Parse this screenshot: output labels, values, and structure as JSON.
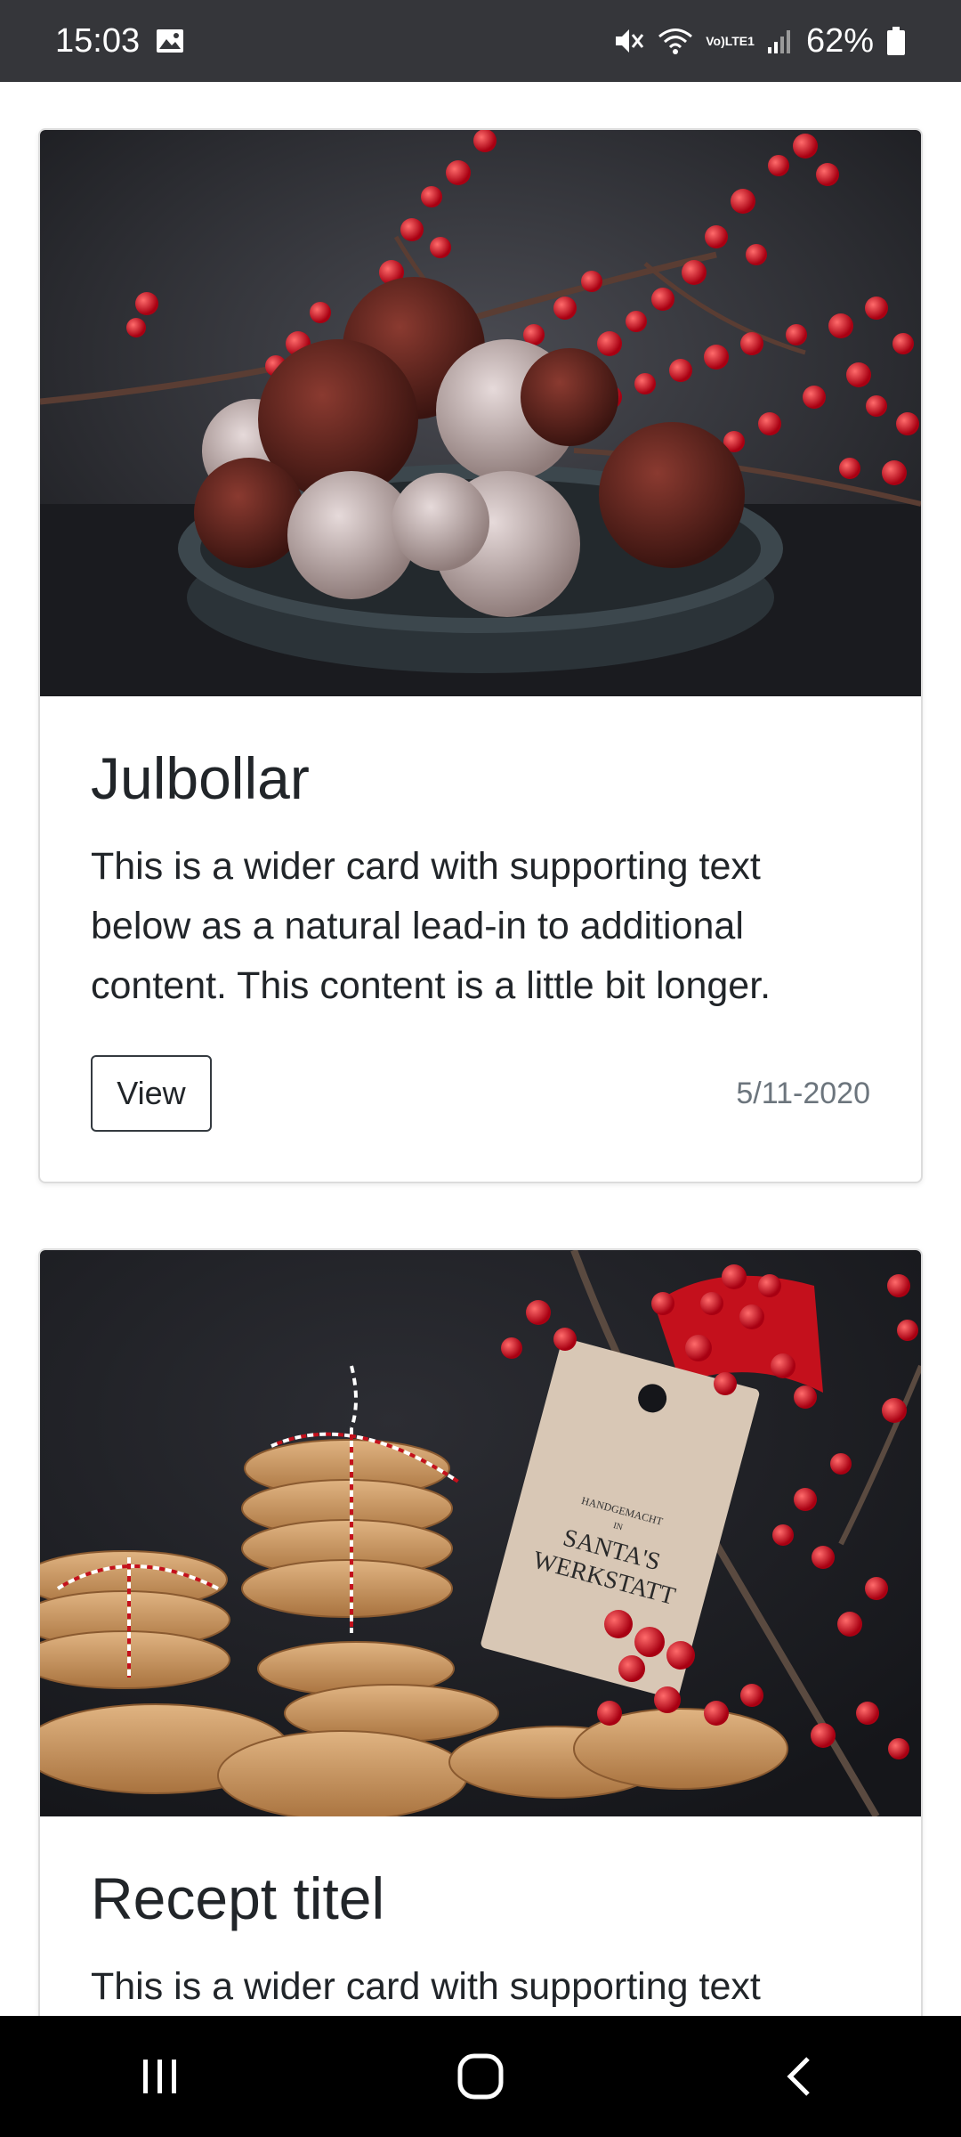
{
  "status_bar": {
    "time": "15:03",
    "battery": "62%",
    "lte_top": "Vo)",
    "lte_bottom": "LTE1",
    "icons": [
      "image-icon",
      "mute-icon",
      "wifi-icon",
      "signal-icon",
      "battery-icon"
    ]
  },
  "cards": [
    {
      "title": "Julbollar",
      "text": "This is a wider card with supporting text below as a natural lead-in to additional content. This content is a little bit longer.",
      "button_label": "View",
      "date": "5/11-2020",
      "image": "chocolate-balls-photo"
    },
    {
      "title": "Recept titel",
      "text": "This is a wider card with supporting text",
      "image": "cookies-photo",
      "tag_line1": "HANDGEMACHT",
      "tag_line2": "IN",
      "tag_line3": "SANTA'S",
      "tag_line4": "WERKSTATT"
    }
  ],
  "nav_bar": {
    "icons": [
      "recent-apps-icon",
      "home-icon",
      "back-icon"
    ]
  },
  "colors": {
    "status_bar": "#35363a",
    "nav_bar": "#000000",
    "text": "#212529",
    "muted": "#6c757d",
    "berry_red": "#c8101e"
  }
}
